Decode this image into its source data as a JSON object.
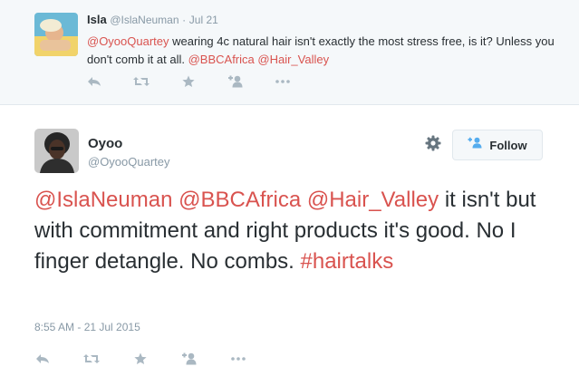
{
  "reply": {
    "name": "Isla",
    "handle": "@IslaNeuman",
    "separator": "·",
    "date": "Jul 21",
    "text": {
      "mention1": "@OyooQuartey",
      "part1": " wearing 4c natural hair isn't exactly the most stress free, is it? Unless you don't comb it at all. ",
      "mention2": "@BBCAfrica",
      "space": " ",
      "mention3": "@Hair_Valley"
    },
    "actions": [
      "reply-icon",
      "retweet-icon",
      "favorite-icon",
      "follow-icon",
      "more-icon"
    ]
  },
  "tweet": {
    "name": "Oyoo",
    "handle": "@OyooQuartey",
    "follow_label": "Follow",
    "text": {
      "mention1": "@IslaNeuman",
      "space1": " ",
      "mention2": "@BBCAfrica",
      "space2": " ",
      "mention3": "@Hair_Valley",
      "body": " it isn't but with commitment and right products it's good. No I finger detangle. No combs. ",
      "hashtag": "#hairtalks"
    },
    "timestamp": "8:55 AM - 21 Jul 2015",
    "actions": [
      "reply-icon",
      "retweet-icon",
      "favorite-icon",
      "follow-icon",
      "more-icon"
    ]
  },
  "colors": {
    "link": "#d9534f",
    "muted": "#8899a6",
    "icon": "#aab8c2",
    "panel_bg": "#f5f8fa",
    "text": "#292f33"
  }
}
